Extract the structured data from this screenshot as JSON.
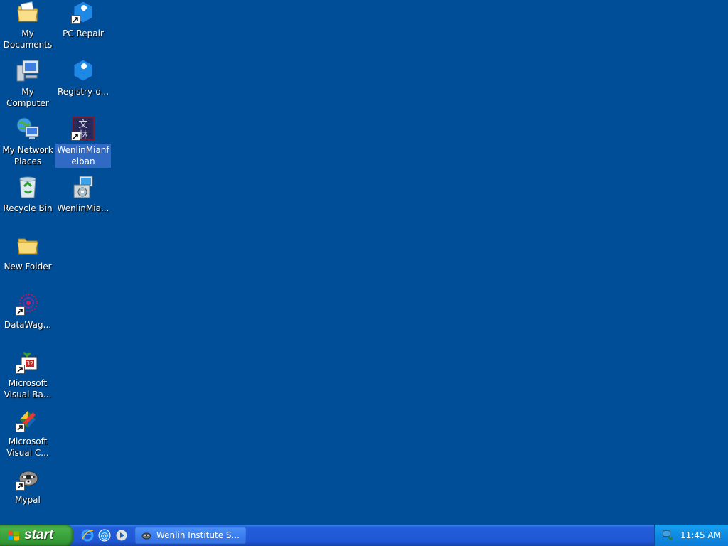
{
  "desktop": {
    "icons": [
      {
        "label": "My Documents",
        "icon": "folder-documents-icon"
      },
      {
        "label": "PC Repair",
        "icon": "wrench-gear-icon"
      },
      {
        "label": "My Computer",
        "icon": "computer-icon"
      },
      {
        "label": "Registry-o...",
        "icon": "wrench-gear-icon"
      },
      {
        "label": "My Network Places",
        "icon": "network-globe-icon"
      },
      {
        "label": "WenlinMianfeiban",
        "icon": "wenlin-icon"
      },
      {
        "label": "Recycle Bin",
        "icon": "recycle-bin-icon"
      },
      {
        "label": "WenlinMia...",
        "icon": "installer-icon"
      },
      {
        "label": "New Folder",
        "icon": "folder-icon"
      },
      {
        "label": "DataWag...",
        "icon": "datawag-icon"
      },
      {
        "label": "Microsoft Visual Ba...",
        "icon": "visual-basic-icon"
      },
      {
        "label": "Microsoft Visual C...",
        "icon": "visual-c-icon"
      },
      {
        "label": "Mypal",
        "icon": "raccoon-icon"
      }
    ]
  },
  "taskbar": {
    "start_label": "start",
    "quick_launch": [
      "internet-explorer-icon",
      "email-icon",
      "media-player-icon"
    ],
    "tasks": [
      {
        "label": "Wenlin Institute S...",
        "icon": "wenlin-task-icon"
      }
    ],
    "tray": {
      "clock": "11:45 AM",
      "icon": "network-tray-icon"
    }
  },
  "colors": {
    "desktop": "#004e98",
    "taskbar": "#245edb",
    "start": "#3c9a3c",
    "selection": "#316ac5"
  }
}
